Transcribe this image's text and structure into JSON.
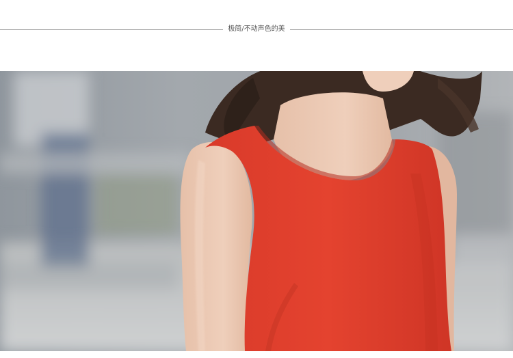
{
  "header": {
    "caption": "极简/不动声色的美"
  },
  "photo": {
    "subject": "woman-in-red-sleeveless-top",
    "colors": {
      "top_red": "#e0402f",
      "skin": "#e9c6b0",
      "hair": "#3b2a22",
      "background_grey": "#9ea3a8"
    }
  }
}
